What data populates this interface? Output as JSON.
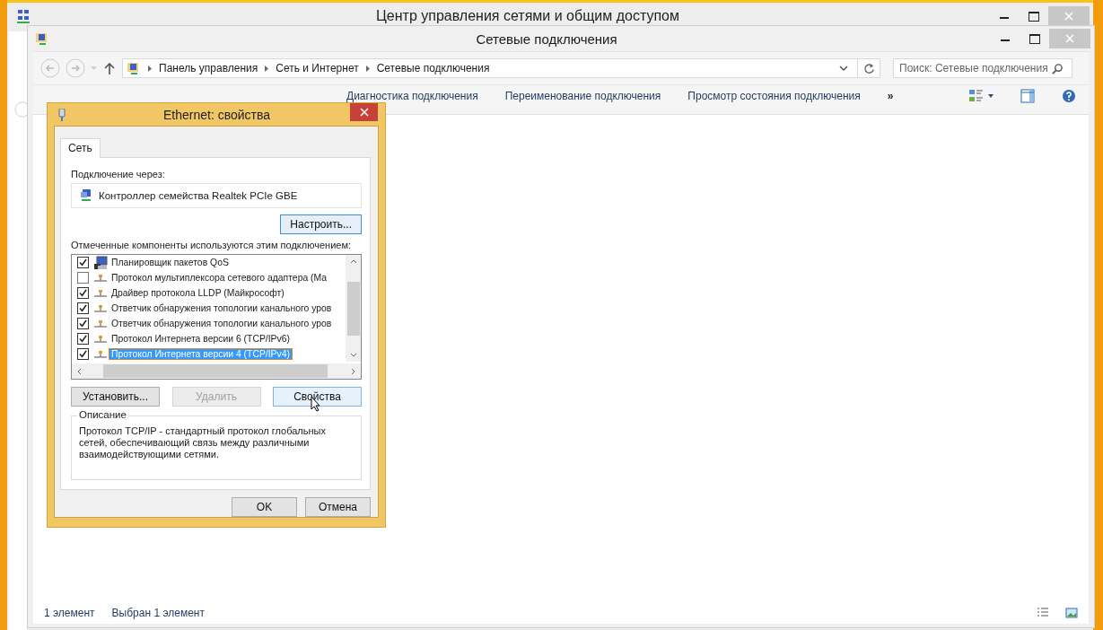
{
  "back_window": {
    "title": "Центр управления сетями и общим доступом"
  },
  "window": {
    "title": "Сетевые подключения"
  },
  "address_bar": {
    "path": [
      "Панель управления",
      "Сеть и Интернет",
      "Сетевые подключения"
    ]
  },
  "search": {
    "placeholder": "Поиск: Сетевые подключения"
  },
  "toolbar": {
    "items": [
      {
        "label": "Диагностика подключения",
        "kind": "command"
      },
      {
        "label": "Переименование подключения",
        "kind": "command"
      },
      {
        "label": "Просмотр состояния подключения",
        "kind": "command"
      },
      {
        "label": "»",
        "kind": "more"
      }
    ]
  },
  "dialog": {
    "title": "Ethernet: свойства",
    "tabs": [
      {
        "label": "Сеть",
        "selected": true
      }
    ],
    "connect_label": "Подключение через:",
    "adapter": "Контроллер семейства Realtek PCIe GBE",
    "configure_button": "Настроить...",
    "components_label": "Отмеченные компоненты используются этим подключением:",
    "components": [
      {
        "label": "Планировщик пакетов QoS",
        "checked": true,
        "selected": false,
        "kind": "computer"
      },
      {
        "label": "Протокол мультиплексора сетевого адаптера (Ма",
        "checked": false,
        "selected": false,
        "kind": "protocol"
      },
      {
        "label": "Драйвер протокола LLDP (Майкрософт)",
        "checked": true,
        "selected": false,
        "kind": "protocol"
      },
      {
        "label": "Ответчик обнаружения топологии канального уров",
        "checked": true,
        "selected": false,
        "kind": "protocol"
      },
      {
        "label": "Ответчик обнаружения топологии канального уров",
        "checked": true,
        "selected": false,
        "kind": "protocol"
      },
      {
        "label": "Протокол Интернета версии 6 (TCP/IPv6)",
        "checked": true,
        "selected": false,
        "kind": "protocol"
      },
      {
        "label": "Протокол Интернета версии 4 (TCP/IPv4)",
        "checked": true,
        "selected": true,
        "kind": "protocol"
      }
    ],
    "buttons": [
      {
        "label": "Установить...",
        "disabled": false
      },
      {
        "label": "Удалить",
        "disabled": true
      },
      {
        "label": "Свойства",
        "disabled": false
      }
    ],
    "description": {
      "legend": "Описание",
      "text": "Протокол TCP/IP - стандартный протокол глобальных сетей, обеспечивающий связь между различными взаимодействующими сетями."
    },
    "footer_buttons": [
      "OK",
      "Отмена"
    ]
  },
  "status_bar": {
    "count": "1 элемент",
    "selection": "Выбран 1 элемент"
  }
}
